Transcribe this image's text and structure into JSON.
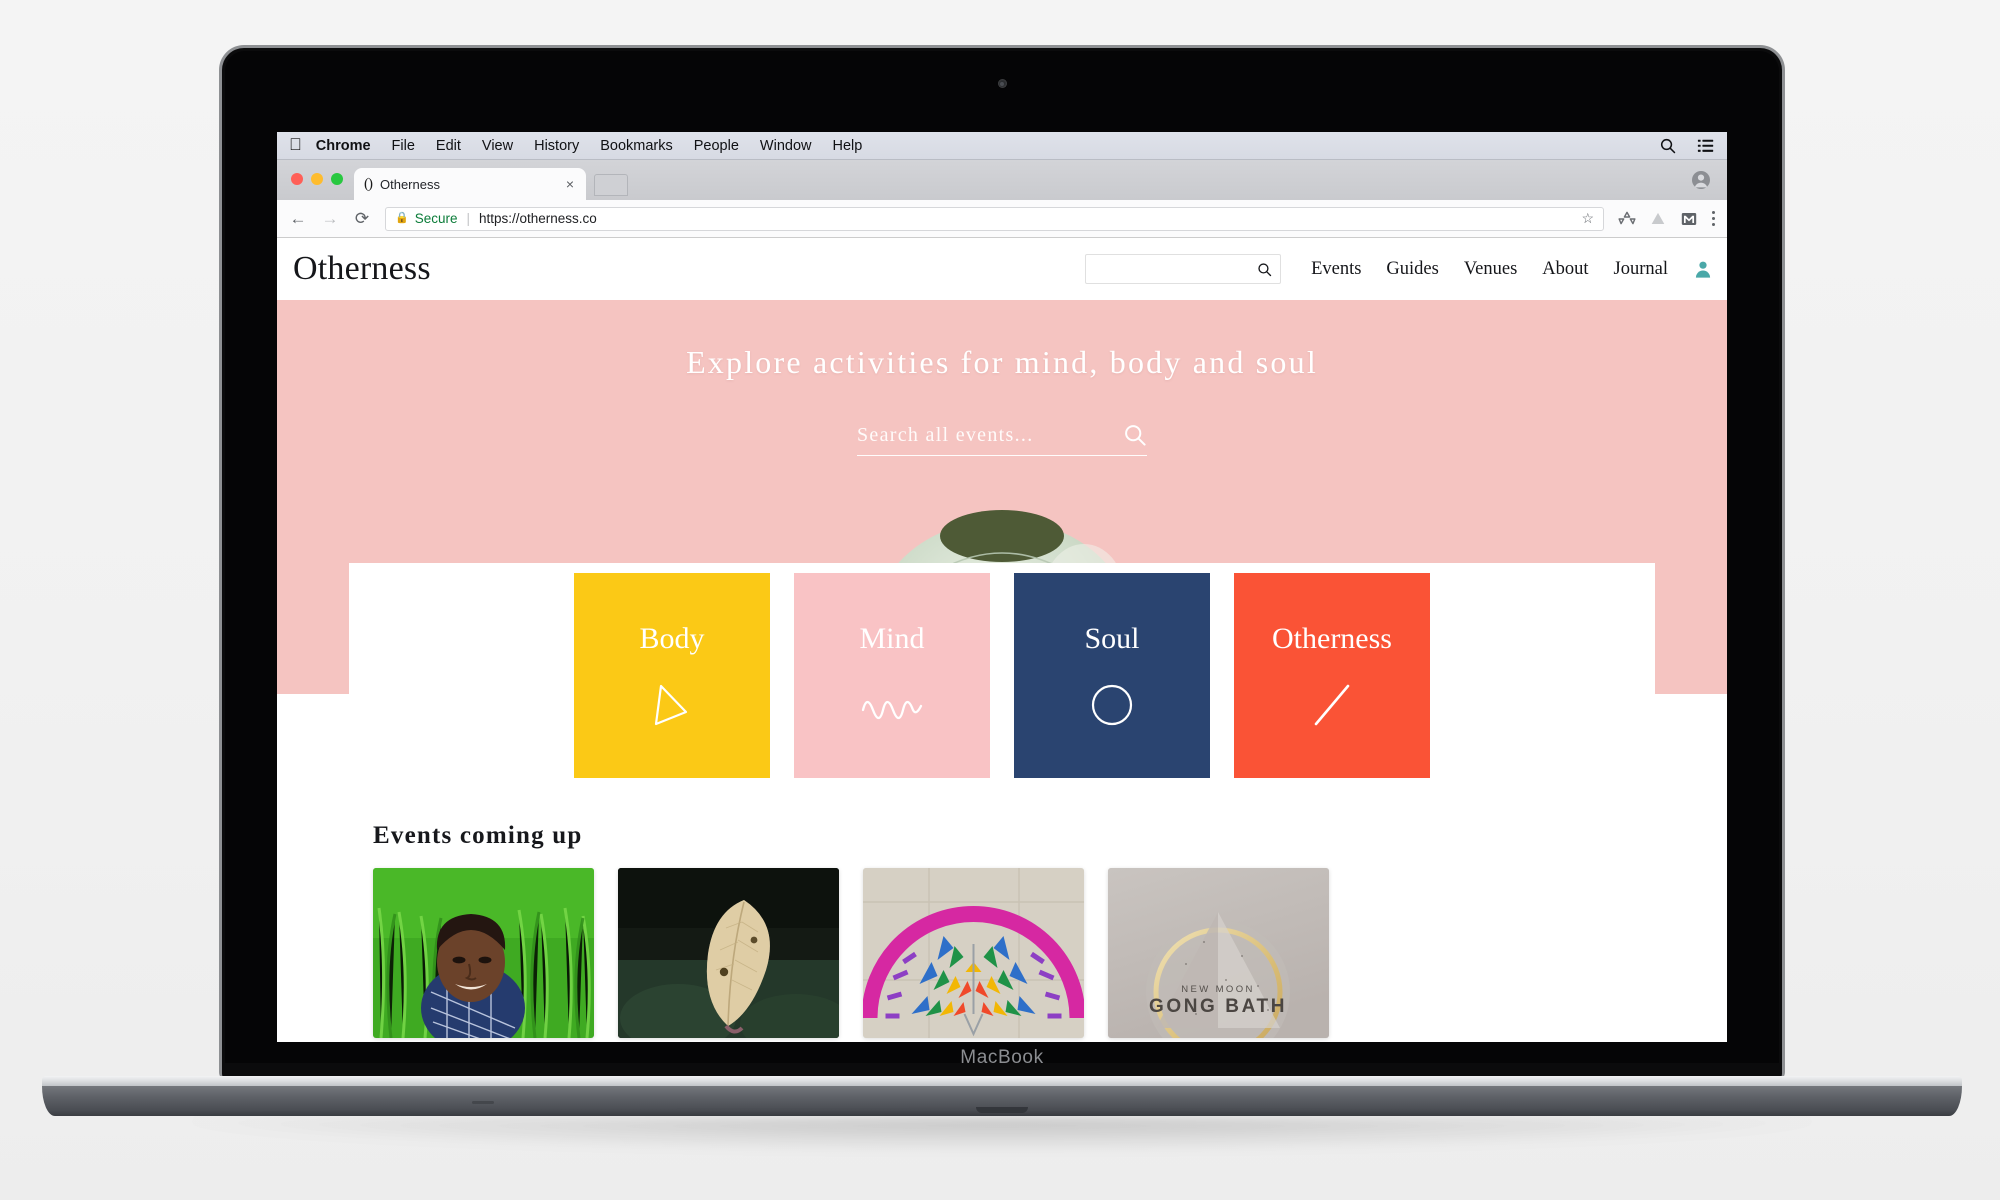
{
  "device": {
    "brand_label": "MacBook"
  },
  "os_menubar": {
    "apple_icon": "apple-logo-icon",
    "items": [
      {
        "label": "Chrome",
        "bold": true
      },
      {
        "label": "File",
        "bold": false
      },
      {
        "label": "Edit",
        "bold": false
      },
      {
        "label": "View",
        "bold": false
      },
      {
        "label": "History",
        "bold": false
      },
      {
        "label": "Bookmarks",
        "bold": false
      },
      {
        "label": "People",
        "bold": false
      },
      {
        "label": "Window",
        "bold": false
      },
      {
        "label": "Help",
        "bold": false
      }
    ],
    "right_icons": [
      "spotlight-search-icon",
      "notification-center-icon"
    ]
  },
  "browser": {
    "traffic_lights": [
      "close-button",
      "minimize-button",
      "maximize-button"
    ],
    "tab": {
      "favicon_text": "()",
      "title": "Otherness",
      "close_label": "×"
    },
    "new_tab_label": "",
    "toolbar": {
      "back_icon": "back-arrow-icon",
      "forward_icon": "forward-arrow-icon",
      "reload_icon": "reload-icon",
      "lock_icon": "padlock-icon",
      "secure_label": "Secure",
      "separator": "|",
      "url": "https://otherness.co",
      "bookmark_icon": "star-icon",
      "extensions": [
        "recycle-extension-icon",
        "google-drive-icon",
        "gmail-icon"
      ],
      "menu_icon": "kebab-menu-icon"
    },
    "profile_icon": "profile-avatar-icon"
  },
  "site": {
    "brand": "Otherness",
    "header_search": {
      "value": "",
      "placeholder": "",
      "icon": "search-icon"
    },
    "nav": [
      {
        "label": "Events"
      },
      {
        "label": "Guides"
      },
      {
        "label": "Venues"
      },
      {
        "label": "About"
      },
      {
        "label": "Journal"
      }
    ],
    "account_icon": "user-account-icon",
    "account_icon_color": "#4aa8a8",
    "hero": {
      "headline": "Explore activities for mind, body and soul",
      "background_color": "#f5c4c1",
      "search": {
        "value": "",
        "placeholder": "Search all events...",
        "icon": "search-icon"
      }
    },
    "categories": [
      {
        "label": "Body",
        "color": "#fbc916",
        "glyph": "triangle-outline-icon"
      },
      {
        "label": "Mind",
        "color": "#f9c3c5",
        "glyph": "wave-line-icon"
      },
      {
        "label": "Soul",
        "color": "#2a4470",
        "glyph": "circle-outline-icon"
      },
      {
        "label": "Otherness",
        "color": "#fa5336",
        "glyph": "diagonal-slash-icon"
      }
    ],
    "events": {
      "title": "Events coming up",
      "cards": [
        {
          "name": "man-in-green-field-photo"
        },
        {
          "name": "dried-leaf-on-dark-photo"
        },
        {
          "name": "colorful-radial-fan-artwork"
        },
        {
          "name": "new-moon-gong-bath-poster",
          "overlay_small": "NEW MOON",
          "overlay_large": "GONG BATH"
        }
      ]
    }
  }
}
